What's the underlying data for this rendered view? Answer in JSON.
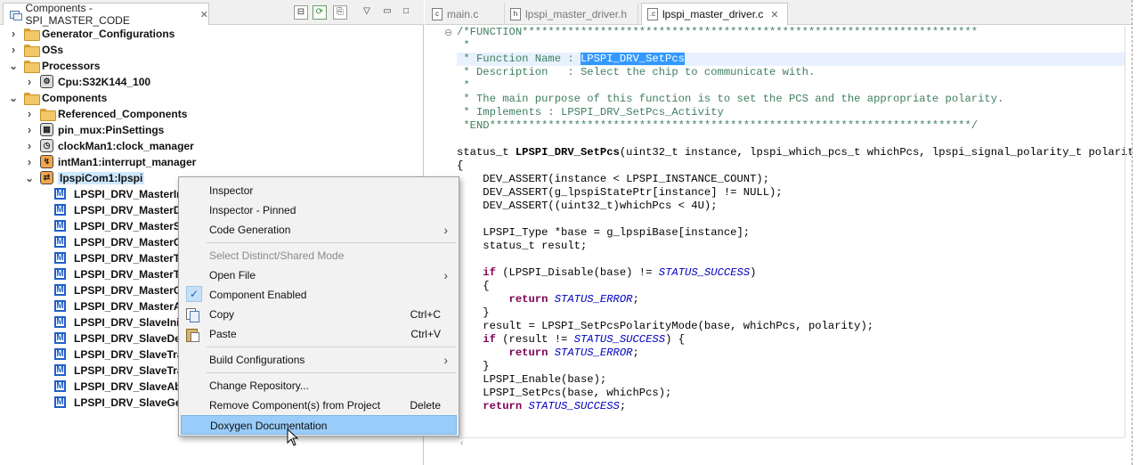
{
  "left_panel": {
    "tab_title": "Components - SPI_MASTER_CODE",
    "toolbar": [
      "collapse-all-icon",
      "refresh-icon",
      "generate-code-icon",
      "view-menu-icon",
      "minimize-icon",
      "maximize-icon"
    ]
  },
  "tree": [
    {
      "label": "Generator_Configurations",
      "expanded": false,
      "icon": "folder-icon"
    },
    {
      "label": "OSs",
      "expanded": false,
      "icon": "folder-icon"
    },
    {
      "label": "Processors",
      "expanded": true,
      "icon": "folder-icon"
    },
    {
      "label": "Cpu:S32K144_100",
      "expanded": false,
      "icon": "cpu-icon"
    },
    {
      "label": "Components",
      "expanded": true,
      "icon": "folder-icon"
    },
    {
      "label": "Referenced_Components",
      "expanded": false,
      "icon": "folder-icon"
    },
    {
      "label": "pin_mux:PinSettings",
      "expanded": false,
      "icon": "pin-mux-icon"
    },
    {
      "label": "clockMan1:clock_manager",
      "expanded": false,
      "icon": "clock-manager-icon"
    },
    {
      "label": "intMan1:interrupt_manager",
      "expanded": false,
      "icon": "interrupt-manager-icon"
    },
    {
      "label": "lpspiCom1:lpspi",
      "expanded": true,
      "icon": "lpspi-icon",
      "selected": true
    },
    {
      "label": "LPSPI_DRV_MasterIn",
      "icon": "method-icon"
    },
    {
      "label": "LPSPI_DRV_MasterD",
      "icon": "method-icon"
    },
    {
      "label": "LPSPI_DRV_MasterSe",
      "icon": "method-icon"
    },
    {
      "label": "LPSPI_DRV_MasterCo",
      "icon": "method-icon"
    },
    {
      "label": "LPSPI_DRV_MasterTr",
      "icon": "method-icon"
    },
    {
      "label": "LPSPI_DRV_MasterTr",
      "icon": "method-icon"
    },
    {
      "label": "LPSPI_DRV_MasterGe",
      "icon": "method-icon"
    },
    {
      "label": "LPSPI_DRV_MasterAb",
      "icon": "method-icon"
    },
    {
      "label": "LPSPI_DRV_SlaveInit",
      "icon": "method-icon"
    },
    {
      "label": "LPSPI_DRV_SlaveDe",
      "icon": "method-icon"
    },
    {
      "label": "LPSPI_DRV_SlaveTra",
      "icon": "method-icon"
    },
    {
      "label": "LPSPI_DRV_SlaveTra",
      "icon": "method-icon"
    },
    {
      "label": "LPSPI_DRV_SlaveAbo",
      "icon": "method-icon"
    },
    {
      "label": "LPSPI_DRV_SlaveGe",
      "icon": "method-icon"
    }
  ],
  "editor": {
    "tabs": [
      {
        "label": "main.c",
        "active": false
      },
      {
        "label": "lpspi_master_driver.h",
        "active": false
      },
      {
        "label": "lpspi_master_driver.c",
        "active": true
      }
    ]
  },
  "context_menu": [
    {
      "label": "Inspector"
    },
    {
      "label": "Inspector - Pinned"
    },
    {
      "label": "Code Generation",
      "submenu": true
    },
    {
      "separator": true
    },
    {
      "label": "Select Distinct/Shared Mode",
      "disabled": true
    },
    {
      "label": "Open File",
      "submenu": true
    },
    {
      "label": "Component Enabled",
      "checked": true
    },
    {
      "label": "Copy",
      "shortcut": "Ctrl+C",
      "icon": "copy-icon"
    },
    {
      "label": "Paste",
      "shortcut": "Ctrl+V",
      "icon": "paste-icon"
    },
    {
      "separator": true
    },
    {
      "label": "Build Configurations",
      "submenu": true
    },
    {
      "separator": true
    },
    {
      "label": "Change Repository..."
    },
    {
      "label": "Remove Component(s) from Project",
      "shortcut": "Delete"
    },
    {
      "label": "Doxygen Documentation",
      "hovered": true
    }
  ],
  "colors": {
    "selection": "#3399ff",
    "menu_hover": "#99ccf8",
    "comment": "#3f7f5f",
    "keyword": "#7f0055",
    "constant": "#0000c0"
  }
}
